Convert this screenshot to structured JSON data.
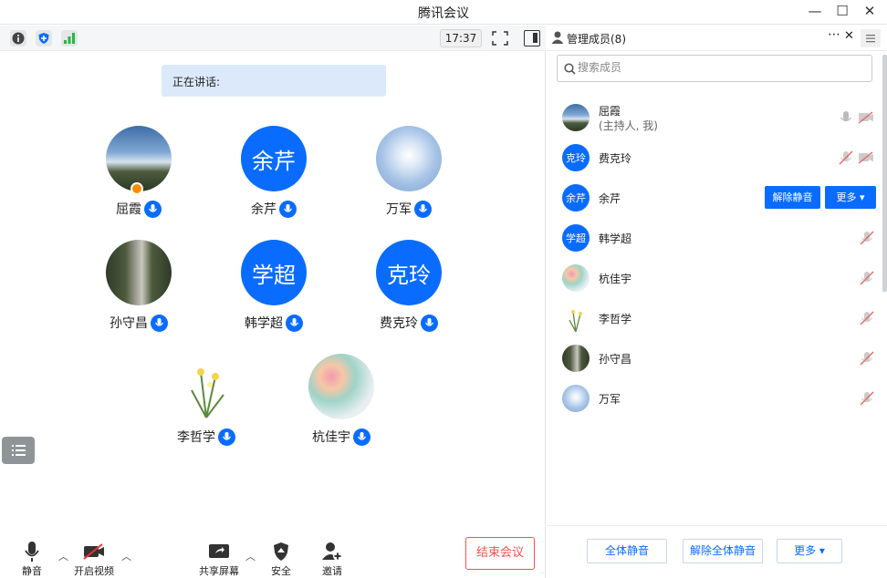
{
  "window": {
    "title": "腾讯会议",
    "minimize": "—",
    "maximize": "☐",
    "close": "✕"
  },
  "toolbar": {
    "time": "17:37"
  },
  "speaking": {
    "label": "正在讲话:"
  },
  "participants": [
    {
      "name": "屈霞",
      "avatar_type": "photo",
      "avatar_desc": "sky-photo",
      "host": true
    },
    {
      "name": "余芹",
      "avatar_type": "text",
      "avatar_text": "余芹"
    },
    {
      "name": "万军",
      "avatar_type": "photo",
      "avatar_desc": "firework-photo"
    },
    {
      "name": "孙守昌",
      "avatar_type": "photo",
      "avatar_desc": "tower-photo"
    },
    {
      "name": "韩学超",
      "avatar_type": "text",
      "avatar_text": "学超"
    },
    {
      "name": "费克玲",
      "avatar_type": "text",
      "avatar_text": "克玲"
    },
    {
      "name": "李哲学",
      "avatar_type": "photo",
      "avatar_desc": "orchid-photo"
    },
    {
      "name": "杭佳宇",
      "avatar_type": "photo",
      "avatar_desc": "flowers-photo"
    }
  ],
  "bottombar": {
    "mute": "静音",
    "video": "开启视频",
    "share": "共享屏幕",
    "security": "安全",
    "invite": "邀请",
    "end": "结束会议"
  },
  "panel": {
    "title": "管理成员(8)",
    "more": "⋯",
    "close": "✕",
    "search_placeholder": "搜索成员",
    "members": [
      {
        "name": "屈霞",
        "sub": "(主持人, 我)",
        "avatar_type": "photo",
        "avatar_desc": "sky-photo"
      },
      {
        "name": "费克玲",
        "avatar_type": "text",
        "avatar_text": "克玲"
      },
      {
        "name": "余芹",
        "avatar_type": "text",
        "avatar_text": "余芹",
        "actions": [
          "解除静音",
          "更多"
        ]
      },
      {
        "name": "韩学超",
        "avatar_type": "text",
        "avatar_text": "学超"
      },
      {
        "name": "杭佳宇",
        "avatar_type": "photo",
        "avatar_desc": "flowers-photo"
      },
      {
        "name": "李哲学",
        "avatar_type": "photo",
        "avatar_desc": "orchid-photo"
      },
      {
        "name": "孙守昌",
        "avatar_type": "photo",
        "avatar_desc": "tower-photo"
      },
      {
        "name": "万军",
        "avatar_type": "photo",
        "avatar_desc": "firework-photo"
      }
    ],
    "footer": {
      "mute_all": "全体静音",
      "unmute_all": "解除全体静音",
      "more": "更多"
    }
  },
  "colors": {
    "accent": "#0a6cff",
    "danger": "#ff4d4f",
    "speaking_bg": "#dce9fb"
  }
}
